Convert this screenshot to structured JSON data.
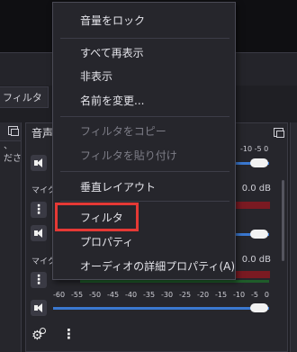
{
  "menu": {
    "items": [
      {
        "label": "音量をロック",
        "enabled": true
      },
      {
        "label": "すべて再表示",
        "enabled": true
      },
      {
        "label": "非表示",
        "enabled": true
      },
      {
        "label": "名前を変更...",
        "enabled": true
      },
      {
        "label": "フィルタをコピー",
        "enabled": false
      },
      {
        "label": "フィルタを貼り付け",
        "enabled": false
      },
      {
        "label": "垂直レイアウト",
        "enabled": true
      },
      {
        "label": "フィルタ",
        "enabled": true,
        "highlighted": true
      },
      {
        "label": "プロパティ",
        "enabled": true
      },
      {
        "label": "オーディオの詳細プロパティ(A)",
        "enabled": true
      }
    ]
  },
  "background": {
    "filters_tab_label": "フィルタ",
    "left_dock_text": [
      "、",
      "ださ"
    ],
    "mixer": {
      "title": "音声",
      "channels": [
        {
          "label": "マイク",
          "db": "0.0 dB"
        },
        {
          "label": "マイク",
          "db": "0.0 dB"
        }
      ],
      "top_meter_ticks": "-10 -5 0",
      "scale_ticks": [
        "-60",
        "-55",
        "-50",
        "-45",
        "-40",
        "-35",
        "-30",
        "-25",
        "-20",
        "-15",
        "-10",
        "-5",
        "0"
      ]
    }
  },
  "colors": {
    "highlight": "#e53935",
    "slider": "#3a78d0",
    "meter_red": "#7a1a22"
  }
}
